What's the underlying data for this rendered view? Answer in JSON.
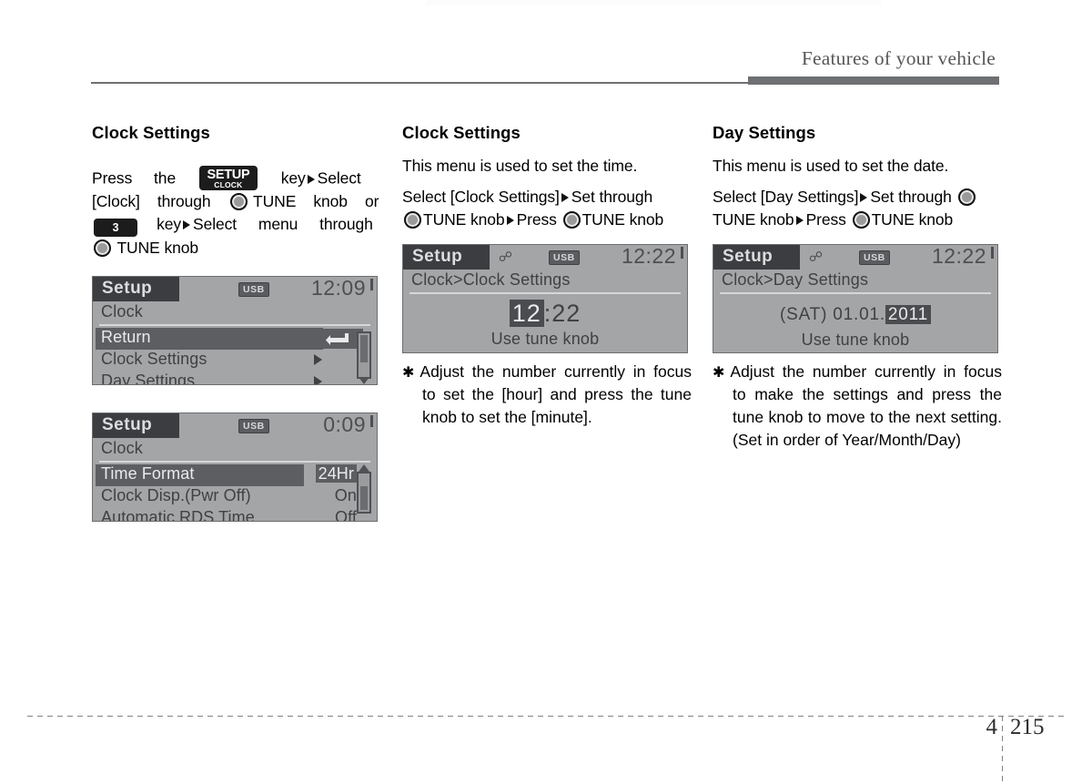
{
  "page": {
    "running_head": "Features of your vehicle",
    "chapter_number": "4",
    "page_number": "215"
  },
  "column_left": {
    "heading": "Clock Settings",
    "instruction": {
      "t1": "Press",
      "t2": "the",
      "key_setup_line1": "SETUP",
      "key_setup_line2": "CLOCK",
      "t3": "key",
      "t4": "Select",
      "t5": "[Clock]",
      "t6": "through",
      "t7": "TUNE",
      "t8": "knob",
      "t9": "or",
      "key_num": "3",
      "t10": "key",
      "t11": "Select",
      "t12": "menu",
      "t13": "through",
      "t14": "TUNE knob"
    },
    "display_1": {
      "tag": "Setup",
      "usb_badge": "USB",
      "clock": "12:09",
      "title": "Clock",
      "rows": [
        {
          "label": "Return",
          "selected": true,
          "icon": "return-arrow-icon"
        },
        {
          "label": "Clock Settings",
          "selected": false,
          "icon": "chevron-right-icon"
        },
        {
          "label": "Day Settings",
          "selected": false,
          "icon": "chevron-right-icon"
        }
      ]
    },
    "display_2": {
      "tag": "Setup",
      "usb_badge": "USB",
      "clock": "0:09",
      "title": "Clock",
      "rows": [
        {
          "label": "Time Format",
          "value": "24Hr",
          "selected": true,
          "value_boxed": true
        },
        {
          "label": "Clock Disp.(Pwr Off)",
          "value": "On",
          "selected": false,
          "value_boxed": false
        },
        {
          "label": "Automatic RDS Time",
          "value": "Off",
          "selected": false,
          "value_boxed": false
        }
      ]
    }
  },
  "column_middle": {
    "heading": "Clock Settings",
    "description": "This menu is used to set the time.",
    "steps": {
      "s1": "Select [Clock Settings]",
      "s2": "Set through",
      "s3": "TUNE knob",
      "s4": "Press",
      "s5": "TUNE knob"
    },
    "display": {
      "tag": "Setup",
      "bt_icon": "bluetooth-icon",
      "usb_badge": "USB",
      "clock": "12:22",
      "title": "Clock>Clock Settings",
      "value_highlight": "12",
      "value_rest": ":22",
      "sub": "Use tune knob"
    },
    "note": "Adjust the number currently in focus to set the [hour] and press the tune knob to set the [minute]."
  },
  "column_right": {
    "heading": "Day Settings",
    "description": "This menu is used to set the date.",
    "steps": {
      "s1": "Select [Day Settings]",
      "s2": "Set through",
      "s3": "TUNE knob",
      "s4": "Press",
      "s5": "TUNE knob"
    },
    "display": {
      "tag": "Setup",
      "bt_icon": "bluetooth-icon",
      "usb_badge": "USB",
      "clock": "12:22",
      "title": "Clock>Day Settings",
      "value_prefix": "(SAT) 01.01.",
      "value_highlight": "2011",
      "sub": "Use tune knob"
    },
    "note": "Adjust the number currently in focus to make the settings and press the tune knob to move to the next setting. (Set in order of Year/Month/Day)"
  }
}
